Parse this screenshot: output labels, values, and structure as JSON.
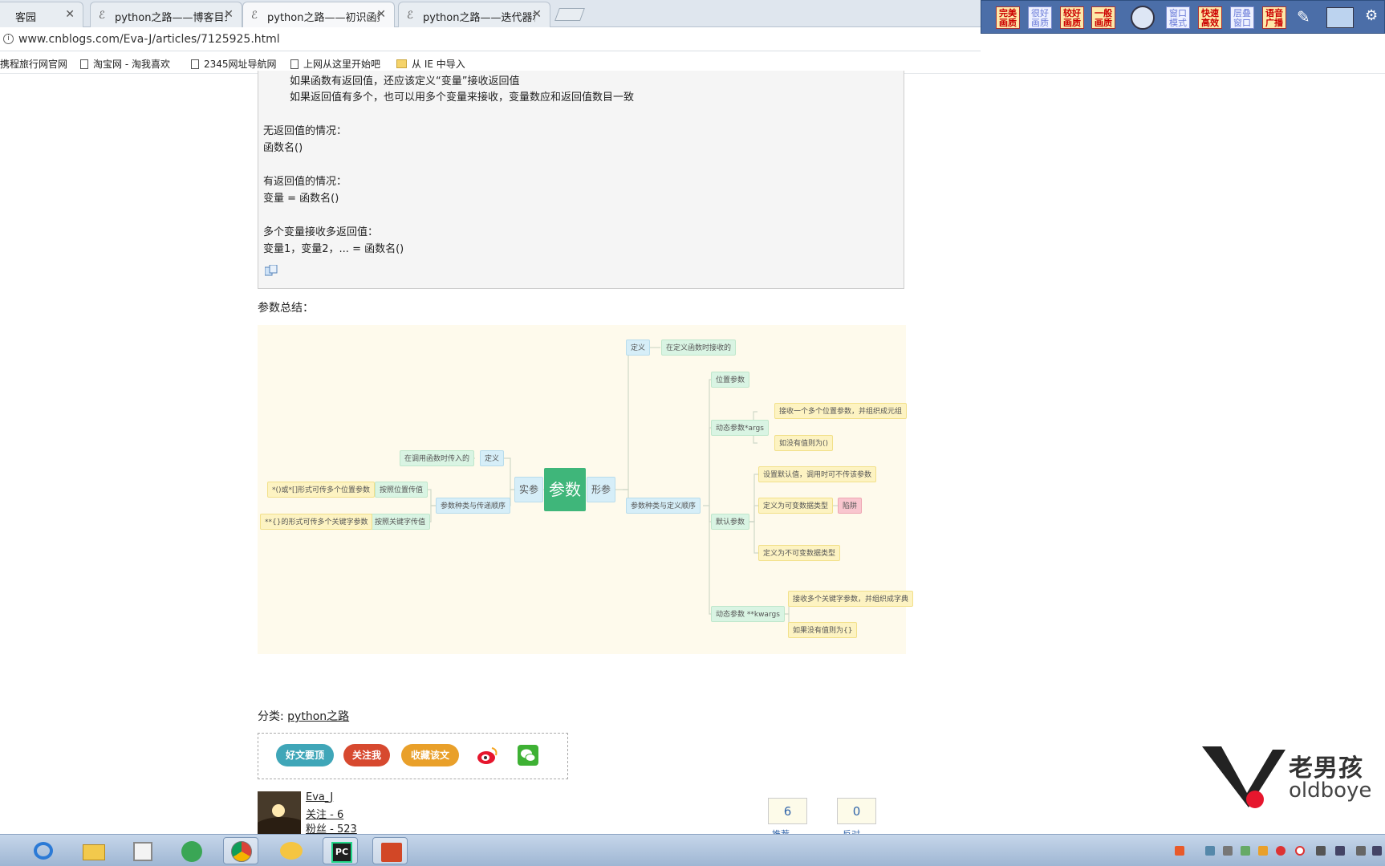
{
  "tabs": [
    {
      "label": "客园",
      "active": false
    },
    {
      "label": "python之路——博客目录",
      "active": false
    },
    {
      "label": "python之路——初识函数",
      "active": true
    },
    {
      "label": "python之路——迭代器和生成器",
      "active": false
    }
  ],
  "address": {
    "url": "www.cnblogs.com/Eva-J/articles/7125925.html"
  },
  "toolbar_ext": [
    "完美画质",
    "很好画质",
    "较好画质",
    "一般画质",
    "窗口模式",
    "快速高效",
    "层叠窗口",
    "语音广播"
  ],
  "bookmarks": [
    "携程旅行网官网",
    "淘宝网 - 淘我喜欢",
    "2345网址导航网",
    "上网从这里开始吧",
    "从 IE 中导入"
  ],
  "code": {
    "lines": [
      "        如果函数有返回值，还应该定义“变量”接收返回值",
      "        如果返回值有多个，也可以用多个变量来接收，变量数应和返回值数目一致",
      "",
      "无返回值的情况：",
      "函数名()",
      "",
      "有返回值的情况：",
      "变量 = 函数名()",
      "",
      "多个变量接收多返回值：",
      "变量1，变量2，... = 函数名()"
    ]
  },
  "section_title": "参数总结：",
  "mindmap": {
    "root": "参数",
    "actual": "实参",
    "formal": "形参",
    "nodes": {
      "def_left": "定义",
      "def_left_desc": "在调用函数时传入的",
      "kinds_left": "参数种类与传递顺序",
      "by_pos": "按照位置传值",
      "by_pos_desc": "*()或*[]形式可传多个位置参数",
      "by_kw": "按照关键字传值",
      "by_kw_desc": "**{}的形式可传多个关键字参数",
      "def_right": "定义",
      "def_right_desc": "在定义函数时接收的",
      "kinds_right": "参数种类与定义顺序",
      "positional": "位置参数",
      "args": "动态参数*args",
      "args_d1": "接收一个多个位置参数，并组织成元组",
      "args_d2": "如没有值则为()",
      "default": "默认参数",
      "default_d1": "设置默认值，调用时可不传该参数",
      "default_d2": "定义为可变数据类型",
      "trap": "陷阱",
      "default_d3": "定义为不可变数据类型",
      "kwargs": "动态参数 **kwargs",
      "kwargs_d1": "接收多个关键字参数，并组织成字典",
      "kwargs_d2": "如果没有值则为{}"
    }
  },
  "category": {
    "label": "分类: ",
    "link": "python之路"
  },
  "share": {
    "b1": "好文要顶",
    "b2": "关注我",
    "b3": "收藏该文"
  },
  "author": {
    "name": "Eva_J",
    "follow": "关注 - 6",
    "fans": "粉丝 - 523"
  },
  "votes": {
    "up": "6",
    "down": "0",
    "up_label": "推荐",
    "down_label": "反对"
  },
  "watermark": {
    "cn": "老男孩",
    "en": "oldboye"
  },
  "colors": {
    "root": "#3fb67a",
    "accent": "#2aa5b8"
  }
}
